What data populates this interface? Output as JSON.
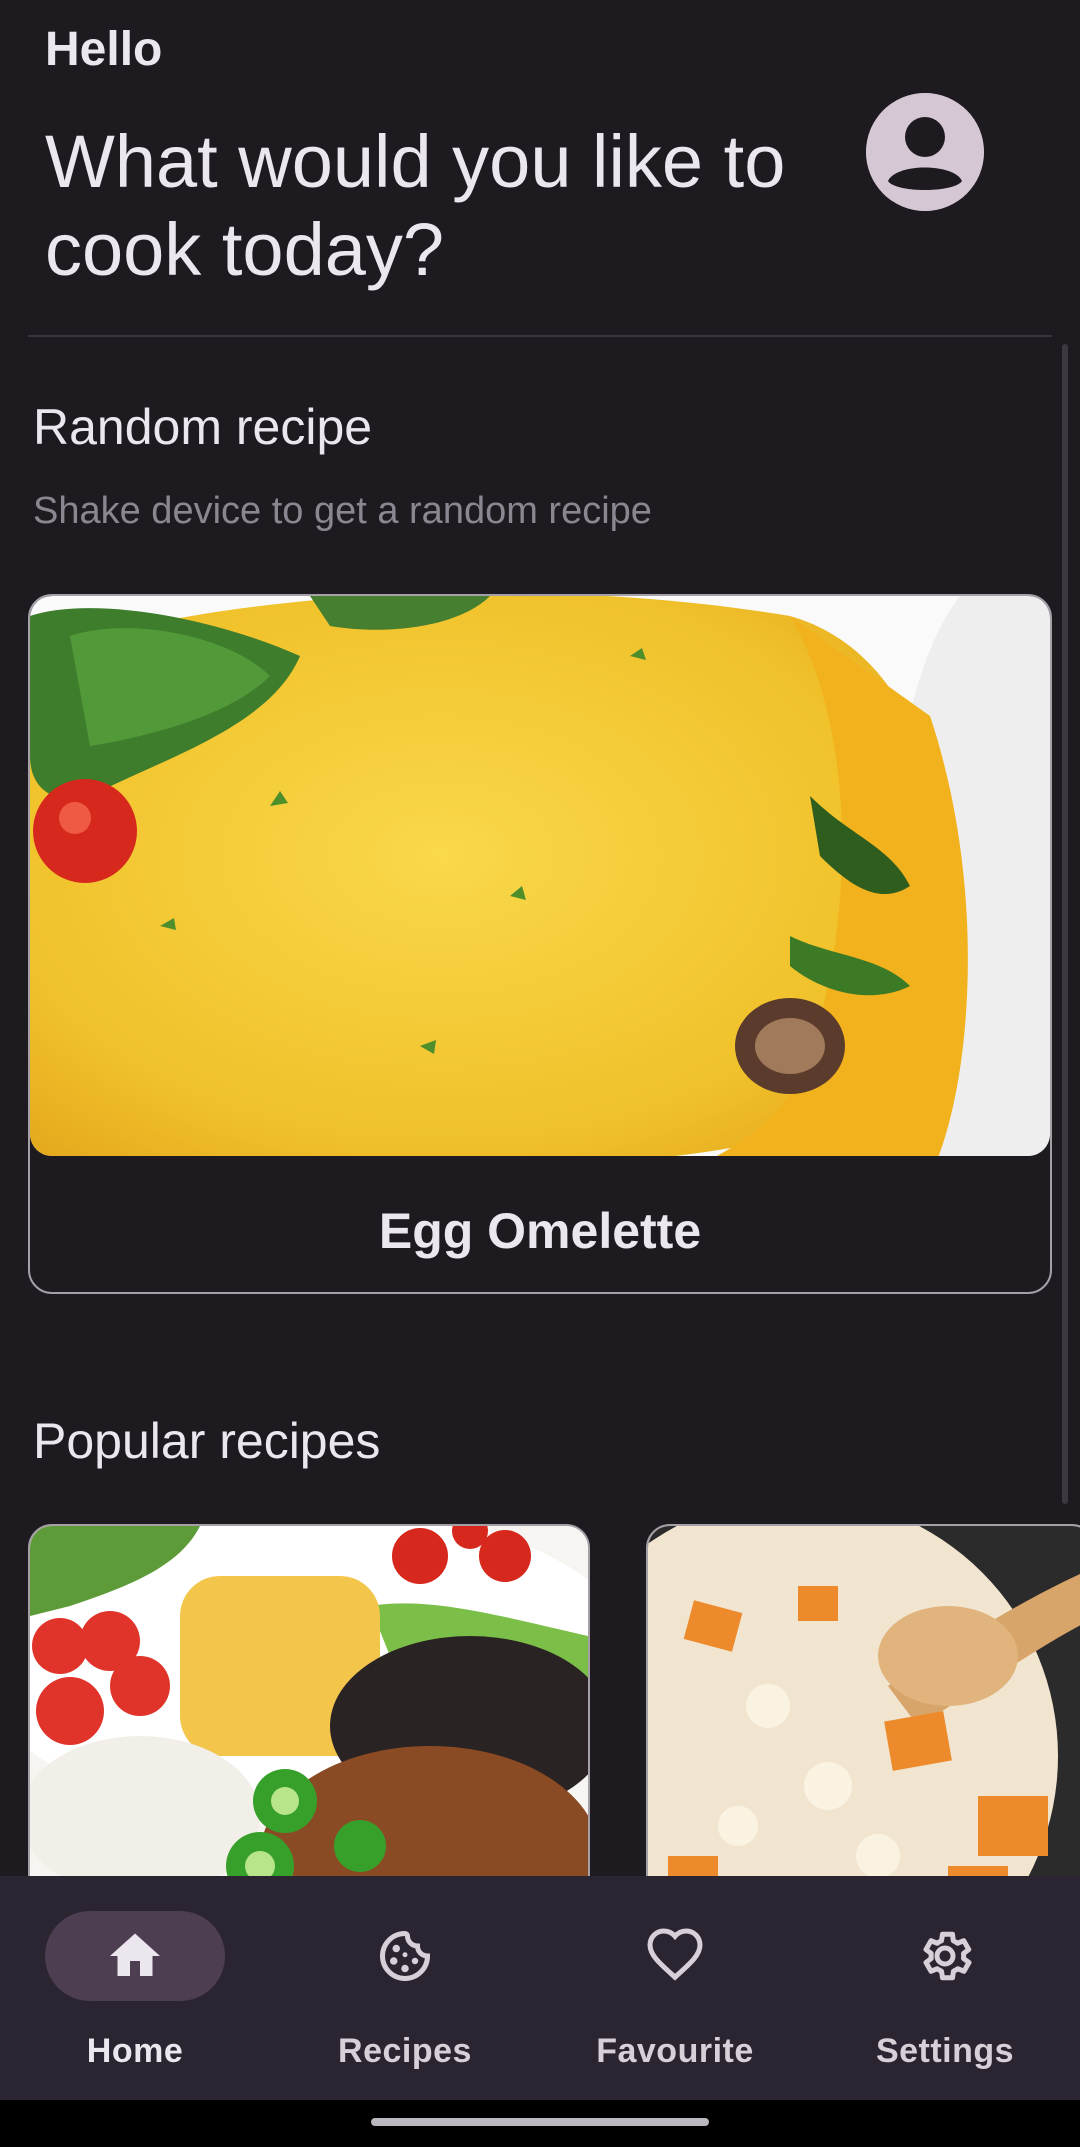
{
  "header": {
    "greeting": "Hello",
    "headline": "What would you like to cook today?"
  },
  "random_section": {
    "title": "Random recipe",
    "subtitle": "Shake device to get a random recipe",
    "recipe_title": "Egg Omelette"
  },
  "popular_section": {
    "title": "Popular recipes"
  },
  "nav": {
    "items": [
      {
        "label": "Home",
        "icon": "home-icon",
        "active": true
      },
      {
        "label": "Recipes",
        "icon": "cookie-icon",
        "active": false
      },
      {
        "label": "Favourite",
        "icon": "heart-icon",
        "active": false
      },
      {
        "label": "Settings",
        "icon": "gear-icon",
        "active": false
      }
    ]
  },
  "colors": {
    "background": "#1e1b20",
    "nav_background": "#2a2530",
    "active_pill": "#4d3e52",
    "avatar": "#d6c7d4",
    "card_border": "#a59fa8"
  }
}
